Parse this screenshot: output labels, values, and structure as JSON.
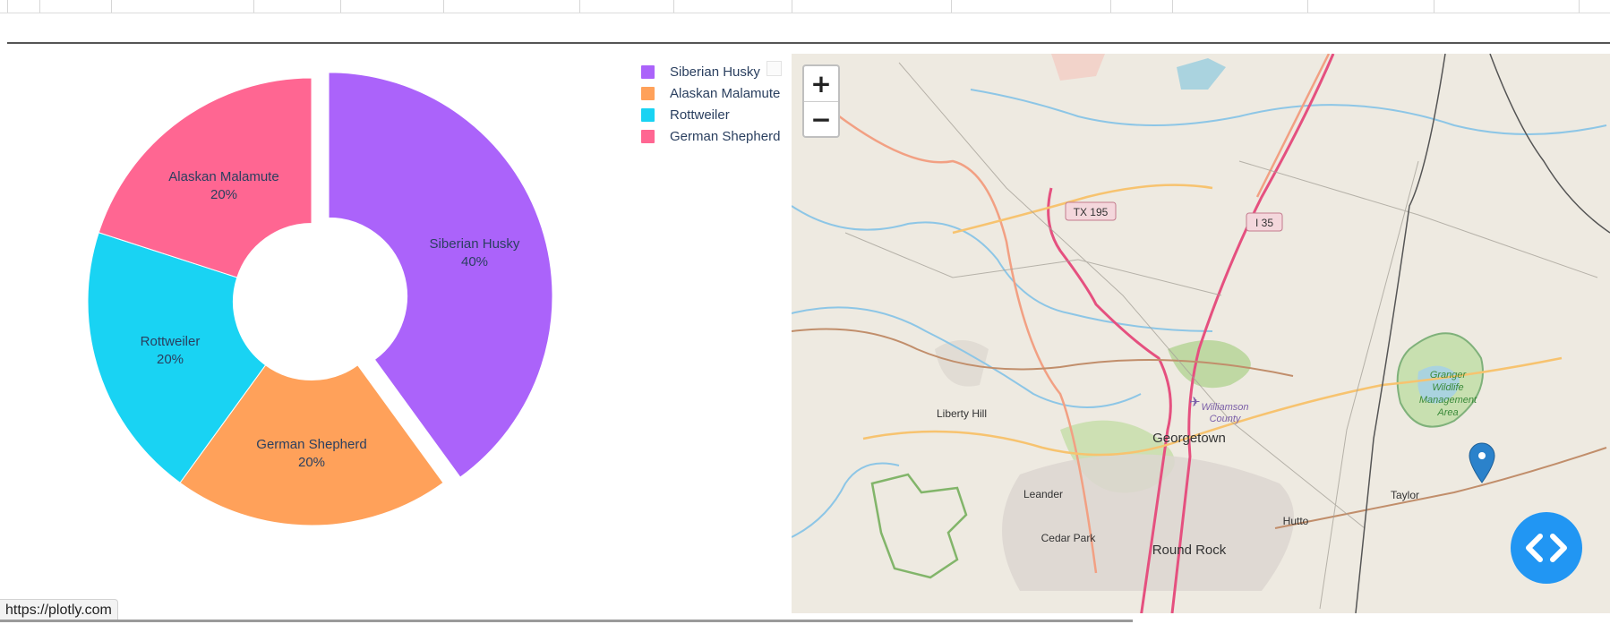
{
  "chart_data": {
    "type": "pie",
    "hole": 0.35,
    "categories": [
      "Siberian Husky",
      "Alaskan Malamute",
      "Rottweiler",
      "German Shepherd"
    ],
    "values": [
      40,
      20,
      20,
      20
    ],
    "percent_labels": [
      "40%",
      "20%",
      "20%",
      "20%"
    ],
    "colors": [
      "#ab63fa",
      "#ffa15a",
      "#19d3f3",
      "#ff6692"
    ],
    "pulled": [
      "Siberian Husky"
    ],
    "legend": {
      "position": "top-right",
      "items": [
        "Siberian Husky",
        "Alaskan Malamute",
        "Rottweiler",
        "German Shepherd"
      ]
    }
  },
  "map": {
    "zoom_in_label": "+",
    "zoom_out_label": "−",
    "places": {
      "tx195": "TX 195",
      "i35": "I 35",
      "liberty_hill": "Liberty Hill",
      "georgetown": "Georgetown",
      "williamson_1": "Williamson",
      "williamson_2": "County",
      "granger_1": "Granger",
      "granger_2": "Wildlife",
      "granger_3": "Management",
      "granger_4": "Area",
      "leander": "Leander",
      "hutto": "Hutto",
      "taylor": "Taylor",
      "cedar_park": "Cedar Park",
      "round_rock": "Round Rock"
    },
    "marker_color": "#2b82cb"
  },
  "code_button": {
    "color": "#2196f3",
    "icon": "code-icon"
  },
  "status_bar": {
    "url": "https://plotly.com"
  }
}
